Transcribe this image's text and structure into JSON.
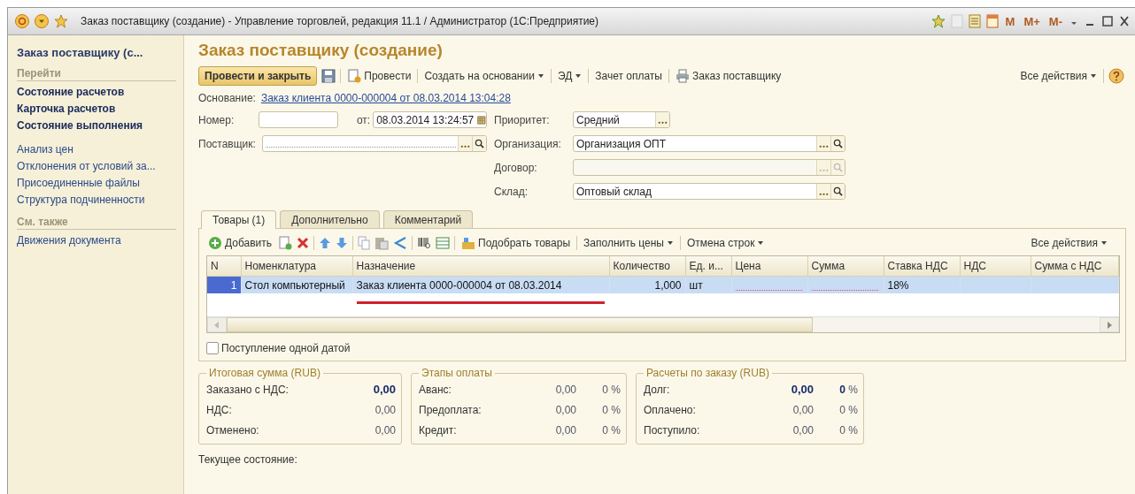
{
  "window": {
    "title": "Заказ поставщику (создание) - Управление торговлей, редакция 11.1 / Администратор  (1С:Предприятие)",
    "memory_buttons": [
      "M",
      "M+",
      "M-"
    ]
  },
  "sidebar": {
    "title": "Заказ поставщику (с...",
    "sections": [
      {
        "heading": "Перейти",
        "items": [
          {
            "label": "Состояние расчетов",
            "bold": true
          },
          {
            "label": "Карточка расчетов",
            "bold": true
          },
          {
            "label": "Состояние выполнения",
            "bold": true
          },
          {
            "label": "Анализ цен",
            "bold": false
          },
          {
            "label": "Отклонения от условий за...",
            "bold": false
          },
          {
            "label": "Присоединенные файлы",
            "bold": false
          },
          {
            "label": "Структура подчиненности",
            "bold": false
          }
        ]
      },
      {
        "heading": "См. также",
        "items": [
          {
            "label": "Движения документа",
            "bold": false
          }
        ]
      }
    ]
  },
  "form": {
    "title": "Заказ поставщику (создание)",
    "toolbar": [
      {
        "kind": "primary",
        "label": "Провести и закрыть"
      },
      {
        "kind": "save"
      },
      {
        "kind": "post",
        "label": "Провести"
      },
      {
        "kind": "menu",
        "label": "Создать на основании"
      },
      {
        "kind": "menu",
        "label": "ЭД"
      },
      {
        "kind": "text",
        "label": "Зачет оплаты"
      },
      {
        "kind": "print",
        "label": "Заказ поставщику"
      }
    ],
    "all_actions": "Все действия",
    "basis": {
      "label": "Основание:",
      "link": "Заказ клиента 0000-000004 от 08.03.2014 13:04:28"
    },
    "number": {
      "label": "Номер:"
    },
    "date": {
      "label": "от:",
      "value": "08.03.2014 13:24:57"
    },
    "priority": {
      "label": "Приоритет:",
      "value": "Средний"
    },
    "supplier": {
      "label": "Поставщик:"
    },
    "right_fields": [
      {
        "label": "Организация:",
        "value": "Организация ОПТ",
        "disabled": false
      },
      {
        "label": "Договор:",
        "disabled": true
      },
      {
        "label": "Склад:",
        "value": "Оптовый склад",
        "disabled": false
      }
    ],
    "tabs": [
      {
        "label": "Товары (1)",
        "selected": true
      },
      {
        "label": "Дополнительно",
        "selected": false
      },
      {
        "label": "Комментарий",
        "selected": false
      }
    ],
    "table_toolbar": [
      {
        "kind": "add",
        "label": "Добавить"
      },
      {
        "kind": "copy-add"
      },
      {
        "kind": "delete"
      },
      {
        "kind": "sep"
      },
      {
        "kind": "up"
      },
      {
        "kind": "down"
      },
      {
        "kind": "sep"
      },
      {
        "kind": "copy"
      },
      {
        "kind": "paste"
      },
      {
        "kind": "share"
      },
      {
        "kind": "sep"
      },
      {
        "kind": "barcode"
      },
      {
        "kind": "sheet"
      },
      {
        "kind": "sep"
      },
      {
        "kind": "pick",
        "label": "Подобрать товары"
      },
      {
        "kind": "menu",
        "label": "Заполнить цены"
      },
      {
        "kind": "menu",
        "label": "Отмена строк"
      }
    ],
    "table_all_actions": "Все действия",
    "table": {
      "columns": [
        {
          "kind": "number",
          "label": "N"
        },
        {
          "kind": "text",
          "label": "Номенклатура"
        },
        {
          "kind": "text",
          "label": "Назначение",
          "underlined": true
        },
        {
          "kind": "number",
          "label": "Количество"
        },
        {
          "kind": "text",
          "label": "Ед. и..."
        },
        {
          "kind": "number",
          "label": "Цена",
          "required": true
        },
        {
          "kind": "number",
          "label": "Сумма",
          "required": true
        },
        {
          "kind": "text",
          "label": "Ставка НДС"
        },
        {
          "kind": "number",
          "label": "НДС"
        },
        {
          "kind": "number",
          "label": "Сумма с НДС"
        }
      ],
      "rows": [
        {
          "cells": [
            "1",
            "Стол компьютерный",
            "Заказ клиента 0000-000004 от 08.03.2014",
            "1,000",
            "шт",
            null,
            null,
            "18%",
            null,
            null
          ],
          "selected": true
        }
      ]
    },
    "single_date": {
      "label": "Поступление одной датой",
      "checked": false
    },
    "groups": [
      {
        "title": "Итоговая сумма (RUB)",
        "rows": [
          {
            "label": "Заказано с НДС:",
            "value": "0,00",
            "bold": true
          },
          {
            "label": "НДС:",
            "value": "0,00",
            "bold": false
          },
          {
            "label": "Отменено:",
            "value": "0,00",
            "bold": false
          }
        ]
      },
      {
        "title": "Этапы оплаты",
        "rows": [
          {
            "label": "Аванс:",
            "value": "0,00",
            "percent": "0",
            "bold": false
          },
          {
            "label": "Предоплата:",
            "value": "0,00",
            "percent": "0",
            "bold": false
          },
          {
            "label": "Кредит:",
            "value": "0,00",
            "percent": "0",
            "bold": false
          }
        ]
      },
      {
        "title": "Расчеты по заказу (RUB)",
        "rows": [
          {
            "label": "Долг:",
            "value": "0,00",
            "percent": "0",
            "bold": true
          },
          {
            "label": "Оплачено:",
            "value": "0,00",
            "percent": "0",
            "bold": false
          },
          {
            "label": "Поступило:",
            "value": "0,00",
            "percent": "0",
            "bold": false
          }
        ]
      }
    ],
    "percent_sign": "%",
    "status_label": "Текущее состояние:"
  }
}
